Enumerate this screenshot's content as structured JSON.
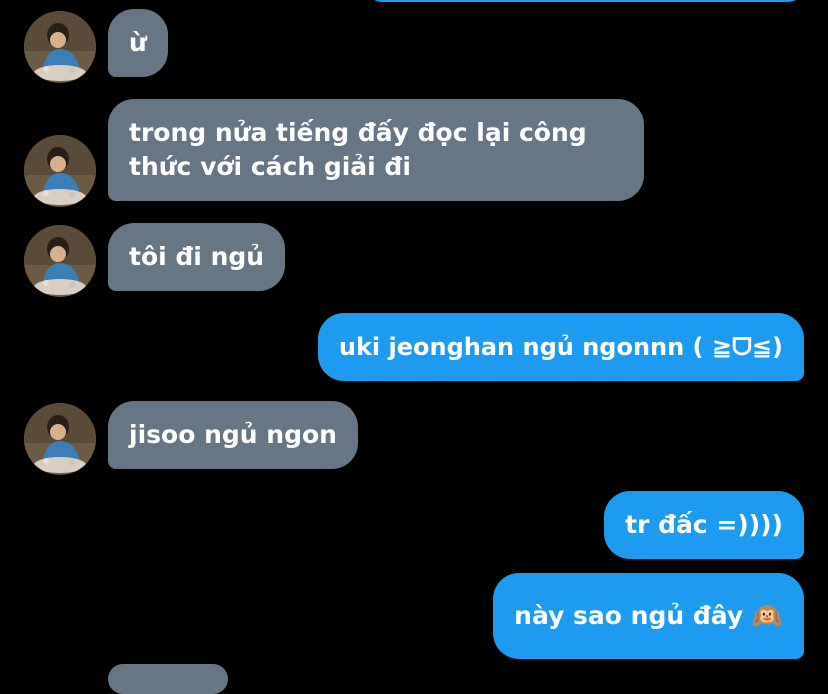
{
  "colors": {
    "background": "#000000",
    "incoming_bubble": "#677684",
    "outgoing_bubble": "#1d9bf0",
    "text": "#ffffff"
  },
  "avatar": {
    "icon": "profile-photo"
  },
  "messages": [
    {
      "direction": "incoming",
      "text": "ừ"
    },
    {
      "direction": "incoming",
      "text": "trong nửa tiếng đấy đọc lại công thức với cách giải đi"
    },
    {
      "direction": "incoming",
      "text": "tôi đi ngủ"
    },
    {
      "direction": "outgoing",
      "text": "uki jeonghan ngủ ngonnn (  ≧ᗜ≦)"
    },
    {
      "direction": "incoming",
      "text": "jisoo ngủ ngon"
    },
    {
      "direction": "outgoing",
      "text": "tr đấc =))))"
    },
    {
      "direction": "outgoing",
      "text": "này sao ngủ đây 🙉"
    }
  ]
}
